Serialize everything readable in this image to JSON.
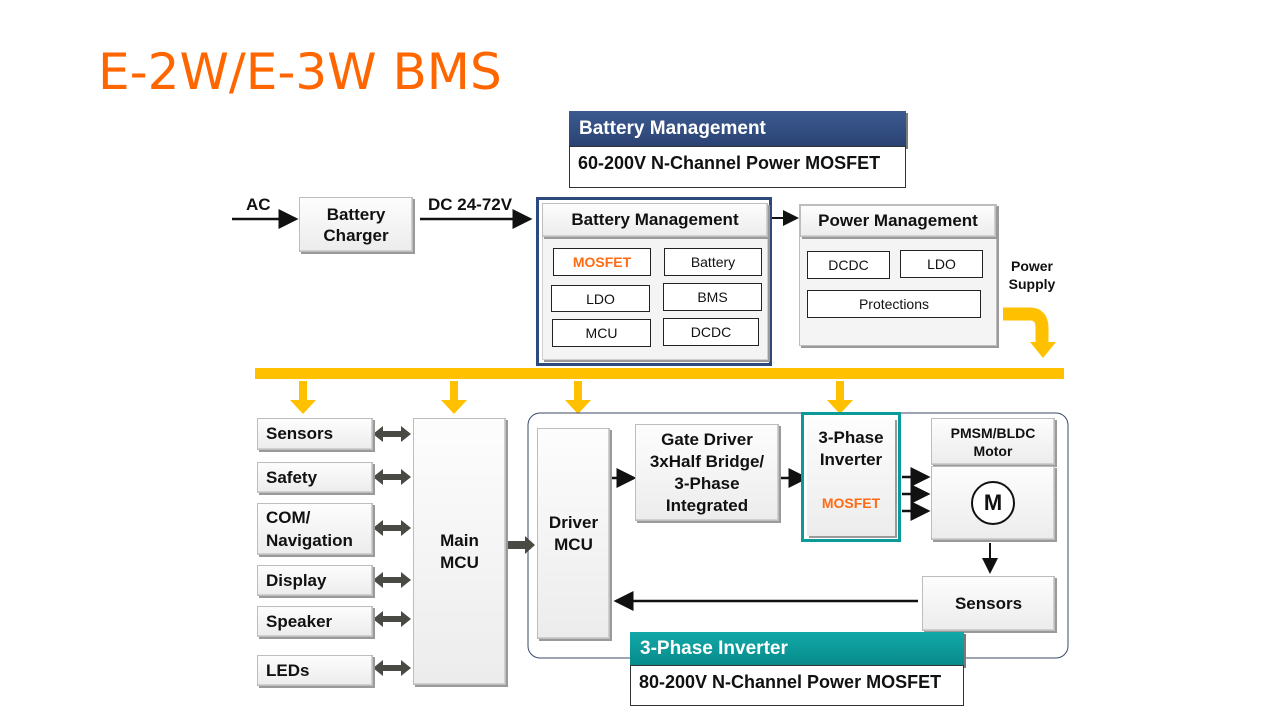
{
  "title": "E-2W/E-3W BMS",
  "colors": {
    "title": "#ff6600",
    "bus": "#ffc000",
    "navy": "#2e4a7d",
    "teal": "#0a9a9a",
    "mosfet": "#ff6a13"
  },
  "callouts": {
    "battery": {
      "header": "Battery Management",
      "body": "60-200V N-Channel Power MOSFET"
    },
    "inverter": {
      "header": "3-Phase Inverter",
      "body": "80-200V N-Channel Power MOSFET"
    }
  },
  "input": {
    "ac_label": "AC",
    "charger": "Battery Charger",
    "dc_label": "DC 24-72V"
  },
  "battery_management": {
    "title": "Battery Management",
    "items": [
      "MOSFET",
      "Battery",
      "LDO",
      "BMS",
      "MCU",
      "DCDC"
    ]
  },
  "power_management": {
    "title": "Power Management",
    "items": [
      "DCDC",
      "LDO",
      "Protections"
    ],
    "supply_label": "Power Supply"
  },
  "peripherals": [
    "Sensors",
    "Safety",
    "COM/ Navigation",
    "Display",
    "Speaker",
    "LEDs"
  ],
  "main_mcu": "Main MCU",
  "motor_drive": {
    "driver_mcu": "Driver MCU",
    "gate_driver": "Gate Driver 3xHalf Bridge/ 3-Phase Integrated",
    "inverter_title": "3-Phase Inverter",
    "inverter_mosfet": "MOSFET",
    "motor_title": "PMSM/BLDC Motor",
    "motor_symbol": "M",
    "sensors": "Sensors"
  }
}
